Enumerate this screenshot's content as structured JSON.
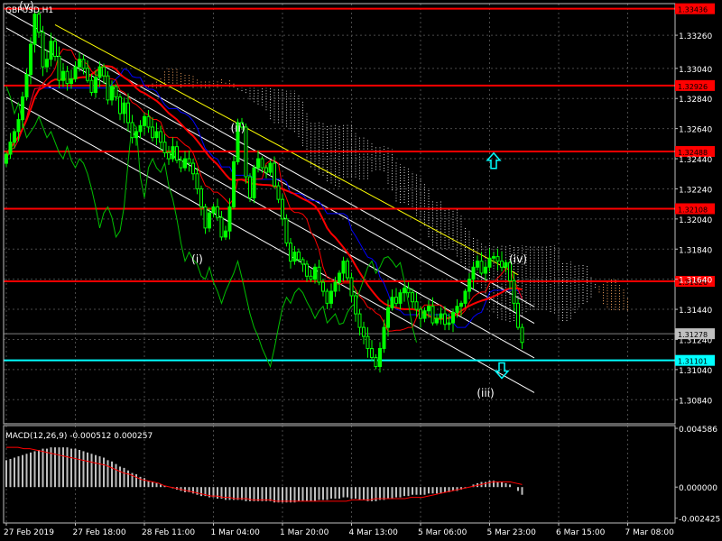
{
  "colors": {
    "background": "#000000",
    "grid": "#4a4a4a",
    "frame": "#c0c0c0",
    "text": "#ffffff",
    "candle": "#00ff00",
    "level_red": "#ff0000",
    "level_cyan": "#00ffff",
    "ma_red": "#ff0000",
    "kijun_blue": "#0000ff",
    "chikou_green": "#00c000",
    "cloud_up": "#f4a460",
    "cloud_down": "#d3d3d3",
    "channel": "#ffffff",
    "trend_yellow": "#ffff00",
    "macd_hist": "#c0c0c0",
    "macd_signal": "#ff0000",
    "arrow": "#00ffff",
    "current_price_box": "#c0c0c0"
  },
  "chart_data": {
    "type": "candlestick",
    "symbol_label": "GBPUSD,H1",
    "y_ticks": [
      "1.33260",
      "1.33040",
      "1.32840",
      "1.32640",
      "1.32440",
      "1.32240",
      "1.32040",
      "1.31840",
      "1.31640",
      "1.31440",
      "1.31240",
      "1.31040",
      "1.30840"
    ],
    "ylim": [
      1.3068,
      1.3347
    ],
    "x_ticks": [
      "27 Feb 2019",
      "27 Feb 18:00",
      "28 Feb 11:00",
      "1 Mar 04:00",
      "1 Mar 20:00",
      "4 Mar 13:00",
      "5 Mar 06:00",
      "5 Mar 23:00",
      "6 Mar 15:00",
      "7 Mar 08:00"
    ],
    "bars_per_tick": 17,
    "price_levels": [
      {
        "label": "1.33436",
        "value": 1.33436,
        "color": "red"
      },
      {
        "label": "1.32926",
        "value": 1.32926,
        "color": "red"
      },
      {
        "label": "1.32488",
        "value": 1.32488,
        "color": "red"
      },
      {
        "label": "1.32108",
        "value": 1.32108,
        "color": "red"
      },
      {
        "label": "1.31626",
        "value": 1.31626,
        "color": "red"
      },
      {
        "label": "1.31101",
        "value": 1.31101,
        "color": "cyan"
      }
    ],
    "current_price": {
      "label": "1.31278",
      "value": 1.31278
    },
    "closes": [
      1.3247,
      1.3255,
      1.3262,
      1.327,
      1.3285,
      1.33,
      1.332,
      1.334,
      1.3328,
      1.3305,
      1.331,
      1.3322,
      1.3312,
      1.3296,
      1.3302,
      1.3294,
      1.3297,
      1.3305,
      1.331,
      1.3304,
      1.3296,
      1.3288,
      1.3298,
      1.3305,
      1.3299,
      1.3283,
      1.3292,
      1.3285,
      1.3274,
      1.3281,
      1.3268,
      1.3258,
      1.3262,
      1.3266,
      1.3272,
      1.3265,
      1.3258,
      1.3262,
      1.3255,
      1.3248,
      1.3244,
      1.3252,
      1.3243,
      1.3238,
      1.3244,
      1.3241,
      1.3234,
      1.3224,
      1.3212,
      1.3198,
      1.3208,
      1.3212,
      1.3205,
      1.3192,
      1.3196,
      1.3212,
      1.3242,
      1.3268,
      1.3265,
      1.3232,
      1.3218,
      1.3238,
      1.3244,
      1.3238,
      1.3235,
      1.3241,
      1.3226,
      1.3217,
      1.3204,
      1.3188,
      1.3176,
      1.3182,
      1.3177,
      1.3174,
      1.3166,
      1.3164,
      1.3172,
      1.3162,
      1.3156,
      1.3148,
      1.3156,
      1.3162,
      1.3168,
      1.3176,
      1.3165,
      1.3153,
      1.3141,
      1.3132,
      1.3126,
      1.3118,
      1.3112,
      1.3106,
      1.3118,
      1.3132,
      1.3145,
      1.3152,
      1.3148,
      1.3155,
      1.3158,
      1.3155,
      1.3149,
      1.3144,
      1.3138,
      1.3143,
      1.3146,
      1.3135,
      1.3138,
      1.3141,
      1.3134,
      1.3135,
      1.3142,
      1.3146,
      1.3148,
      1.3156,
      1.3164,
      1.3172,
      1.3176,
      1.3168,
      1.3172,
      1.3178,
      1.3179,
      1.3176,
      1.3172,
      1.3175,
      1.3163,
      1.3148,
      1.3132,
      1.3122
    ],
    "macd": {
      "label": "MACD(12,26,9) -0.000512 0.000257",
      "y_ticks": [
        "0.004586",
        "0.000000",
        "-0.002425"
      ],
      "ylim": [
        -0.0028,
        0.0048
      ],
      "histogram": [
        0.0021,
        0.0022,
        0.0023,
        0.0024,
        0.0025,
        0.0026,
        0.0027,
        0.0028,
        0.0029,
        0.003,
        0.003,
        0.0031,
        0.0031,
        0.0031,
        0.0031,
        0.0031,
        0.003,
        0.003,
        0.0029,
        0.0028,
        0.0027,
        0.0026,
        0.0025,
        0.0024,
        0.0023,
        0.0021,
        0.002,
        0.0018,
        0.0016,
        0.0015,
        0.0013,
        0.0011,
        0.001,
        0.0008,
        0.0007,
        0.0005,
        0.0004,
        0.0003,
        0.0002,
        0.0001,
        0.0,
        -0.0001,
        -0.0002,
        -0.0003,
        -0.0004,
        -0.0004,
        -0.0005,
        -0.0006,
        -0.0007,
        -0.0007,
        -0.0008,
        -0.0008,
        -0.0009,
        -0.0009,
        -0.001,
        -0.001,
        -0.001,
        -0.001,
        -0.001,
        -0.0011,
        -0.0011,
        -0.0011,
        -0.0011,
        -0.0011,
        -0.0011,
        -0.0011,
        -0.0012,
        -0.0012,
        -0.0012,
        -0.0012,
        -0.0012,
        -0.0012,
        -0.0011,
        -0.0011,
        -0.0011,
        -0.0011,
        -0.0011,
        -0.001,
        -0.001,
        -0.001,
        -0.0009,
        -0.0009,
        -0.0009,
        -0.0008,
        -0.0008,
        -0.0009,
        -0.0009,
        -0.001,
        -0.001,
        -0.0011,
        -0.0011,
        -0.0011,
        -0.001,
        -0.001,
        -0.0009,
        -0.0009,
        -0.0008,
        -0.0008,
        -0.0007,
        -0.0007,
        -0.0006,
        -0.0006,
        -0.0006,
        -0.0006,
        -0.0005,
        -0.0005,
        -0.0005,
        -0.0005,
        -0.0004,
        -0.0004,
        -0.0003,
        -0.0003,
        -0.0002,
        -0.0001,
        0.0,
        0.0002,
        0.0003,
        0.0004,
        0.0004,
        0.0005,
        0.0005,
        0.0004,
        0.0004,
        0.0003,
        0.0002,
        0.0,
        -0.0003,
        -0.0006
      ],
      "signal": [
        0.0031,
        0.0031,
        0.0031,
        0.003,
        0.003,
        0.0029,
        0.0028,
        0.0027,
        0.0026,
        0.0025,
        0.0024,
        0.0023,
        0.0022,
        0.0021,
        0.002,
        0.0019,
        0.0018,
        0.0017,
        0.0015,
        0.0013,
        0.0011,
        0.001,
        0.0008,
        0.0006,
        0.0005,
        0.0004,
        0.0003,
        0.0001,
        0.0,
        -0.0001,
        -0.0002,
        -0.0003,
        -0.0004,
        -0.0005,
        -0.0006,
        -0.0007,
        -0.0007,
        -0.0008,
        -0.0008,
        -0.0009,
        -0.0009,
        -0.0009,
        -0.001,
        -0.001,
        -0.001,
        -0.001,
        -0.0011,
        -0.0011,
        -0.0011,
        -0.0011,
        -0.0011,
        -0.0011,
        -0.0011,
        -0.0011,
        -0.0011,
        -0.0011,
        -0.0011,
        -0.0011,
        -0.0011,
        -0.001,
        -0.001,
        -0.001,
        -0.001,
        -0.0009,
        -0.0009,
        -0.0009,
        -0.0009,
        -0.0009,
        -0.0009,
        -0.0008,
        -0.0008,
        -0.0008,
        -0.0007,
        -0.0006,
        -0.0005,
        -0.0004,
        -0.0003,
        -0.0002,
        -0.0001,
        0.0,
        0.0001,
        0.0002,
        0.0003,
        0.0004,
        0.0004,
        0.0004,
        0.0004,
        0.0003,
        0.0002
      ]
    },
    "annotations": [
      {
        "label": "(v)",
        "value": 1.3343,
        "bar": 5,
        "color": "white"
      },
      {
        "label": "(ii)",
        "value": 1.3262,
        "bar": 57,
        "color": "white"
      },
      {
        "label": "(i)",
        "value": 1.3175,
        "bar": 47,
        "color": "white"
      },
      {
        "label": "(iv)",
        "value": 1.3175,
        "bar": 126,
        "color": "white"
      },
      {
        "label": "(iii)",
        "value": 1.3086,
        "bar": 118,
        "color": "white"
      }
    ],
    "arrows": [
      {
        "icon": "arrow-up-icon",
        "bar": 120,
        "value": 1.3243,
        "direction": "up"
      },
      {
        "icon": "arrow-down-icon",
        "bar": 122,
        "value": 1.3103,
        "direction": "down"
      }
    ],
    "grid": true
  }
}
